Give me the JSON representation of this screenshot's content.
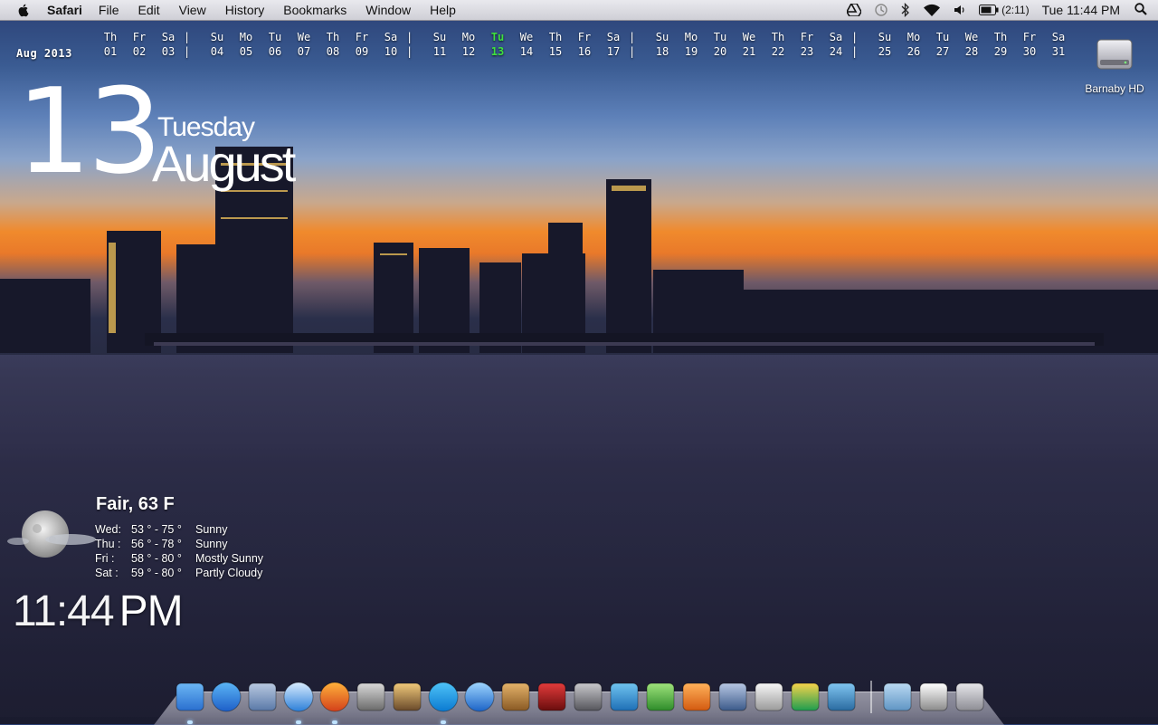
{
  "menubar": {
    "app_name": "Safari",
    "menus": [
      "File",
      "Edit",
      "View",
      "History",
      "Bookmarks",
      "Window",
      "Help"
    ],
    "battery_time": "(2:11)",
    "clock": "Tue 11:44 PM"
  },
  "calendar_strip": {
    "month_label": "Aug 2013",
    "today_index": 12,
    "days": [
      {
        "name": "Th",
        "num": "01"
      },
      {
        "name": "Fr",
        "num": "02"
      },
      {
        "name": "Sa",
        "num": "03"
      },
      {
        "name": "Su",
        "num": "04"
      },
      {
        "name": "Mo",
        "num": "05"
      },
      {
        "name": "Tu",
        "num": "06"
      },
      {
        "name": "We",
        "num": "07"
      },
      {
        "name": "Th",
        "num": "08"
      },
      {
        "name": "Fr",
        "num": "09"
      },
      {
        "name": "Sa",
        "num": "10"
      },
      {
        "name": "Su",
        "num": "11"
      },
      {
        "name": "Mo",
        "num": "12"
      },
      {
        "name": "Tu",
        "num": "13"
      },
      {
        "name": "We",
        "num": "14"
      },
      {
        "name": "Th",
        "num": "15"
      },
      {
        "name": "Fr",
        "num": "16"
      },
      {
        "name": "Sa",
        "num": "17"
      },
      {
        "name": "Su",
        "num": "18"
      },
      {
        "name": "Mo",
        "num": "19"
      },
      {
        "name": "Tu",
        "num": "20"
      },
      {
        "name": "We",
        "num": "21"
      },
      {
        "name": "Th",
        "num": "22"
      },
      {
        "name": "Fr",
        "num": "23"
      },
      {
        "name": "Sa",
        "num": "24"
      },
      {
        "name": "Su",
        "num": "25"
      },
      {
        "name": "Mo",
        "num": "26"
      },
      {
        "name": "Tu",
        "num": "27"
      },
      {
        "name": "We",
        "num": "28"
      },
      {
        "name": "Th",
        "num": "29"
      },
      {
        "name": "Fr",
        "num": "30"
      },
      {
        "name": "Sa",
        "num": "31"
      }
    ],
    "separator": "|"
  },
  "big_date": {
    "day": "13",
    "weekday": "Tuesday",
    "month": "August"
  },
  "desktop": {
    "drive_label": "Barnaby HD"
  },
  "weather": {
    "current": "Fair, 63 F",
    "forecast": [
      {
        "day": "Wed:",
        "range": "53 ° - 75 °",
        "cond": "Sunny"
      },
      {
        "day": "Thu :",
        "range": "56 ° - 78 °",
        "cond": "Sunny"
      },
      {
        "day": "Fri   :",
        "range": "58 ° - 80 °",
        "cond": "Mostly Sunny"
      },
      {
        "day": "Sat  :",
        "range": "59 ° - 80 °",
        "cond": "Partly Cloudy"
      }
    ]
  },
  "time_display": {
    "digits": "11:44",
    "ampm": "PM"
  },
  "colors": {
    "today_highlight": "#3ee03e",
    "menubar_bg": "#dcdce2"
  },
  "dock": {
    "apps": [
      "finder-icon",
      "app-store-icon",
      "mail-icon",
      "safari-icon",
      "firefox-icon",
      "preview-icon",
      "iphoto-icon",
      "skype-icon",
      "itunes-icon",
      "address-book-icon",
      "photo-booth-icon",
      "system-preferences-icon",
      "word-icon",
      "excel-icon",
      "powerpoint-icon",
      "photo-viewer-icon",
      "textedit-icon",
      "google-drive-icon",
      "remote-icon"
    ],
    "others": [
      "downloads-folder-icon",
      "document-stack-icon",
      "trash-icon"
    ]
  }
}
